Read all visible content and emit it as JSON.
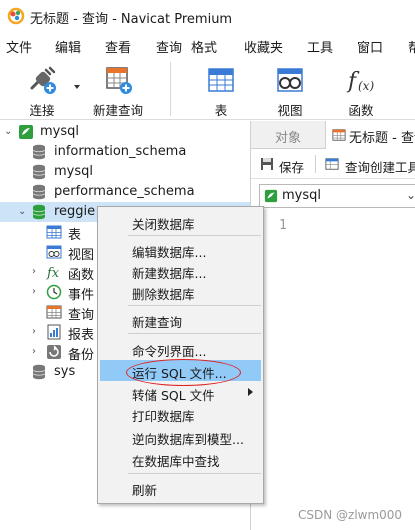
{
  "window": {
    "title": "无标题 - 查询 - Navicat Premium"
  },
  "menubar": [
    "文件",
    "编辑",
    "查看",
    "查询",
    "格式",
    "收藏夹",
    "工具",
    "窗口",
    "帮"
  ],
  "toolbar": {
    "connect": "连接",
    "new_query": "新建查询",
    "table": "表",
    "view": "视图",
    "function": "函数"
  },
  "tree": {
    "connection": "mysql",
    "databases": {
      "information_schema": "information_schema",
      "mysql": "mysql",
      "performance_schema": "performance_schema",
      "reggie": "reggie",
      "sys": "sys"
    },
    "reggie_children": {
      "tables": "表",
      "views": "视图",
      "functions": "函数",
      "events": "事件",
      "queries": "查询",
      "reports": "报表",
      "backups": "备份"
    }
  },
  "right": {
    "tab_object": "对象",
    "tab_query": "无标题 - 查询",
    "save": "保存",
    "query_builder": "查询创建工具",
    "connection_select": "mysql",
    "line_number": "1"
  },
  "context_menu": {
    "close_db": "关闭数据库",
    "edit_db": "编辑数据库...",
    "new_db": "新建数据库...",
    "delete_db": "删除数据库",
    "new_query": "新建查询",
    "console": "命令列界面...",
    "run_sql": "运行 SQL 文件...",
    "dump_sql": "转储 SQL 文件",
    "print_db": "打印数据库",
    "reverse_model": "逆向数据库到模型...",
    "find_in_db": "在数据库中查找",
    "refresh": "刷新"
  },
  "watermark": "CSDN @zlwm000"
}
